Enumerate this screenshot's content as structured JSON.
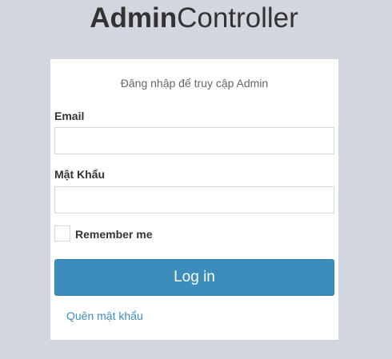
{
  "logo": {
    "bold": "Admin",
    "rest": "Controller"
  },
  "login": {
    "message": "Đăng nhập để truy cập Admin",
    "email_label": "Email",
    "email_value": "",
    "password_label": "Mật Khẩu",
    "password_value": "",
    "remember_label": "Remember me",
    "remember_checked": false,
    "submit_label": "Log in",
    "forgot_link": "Quên mật khẩu"
  },
  "colors": {
    "page_background": "#d2d6de",
    "box_background": "#ffffff",
    "primary": "#3c8dbc",
    "text": "#333333"
  }
}
